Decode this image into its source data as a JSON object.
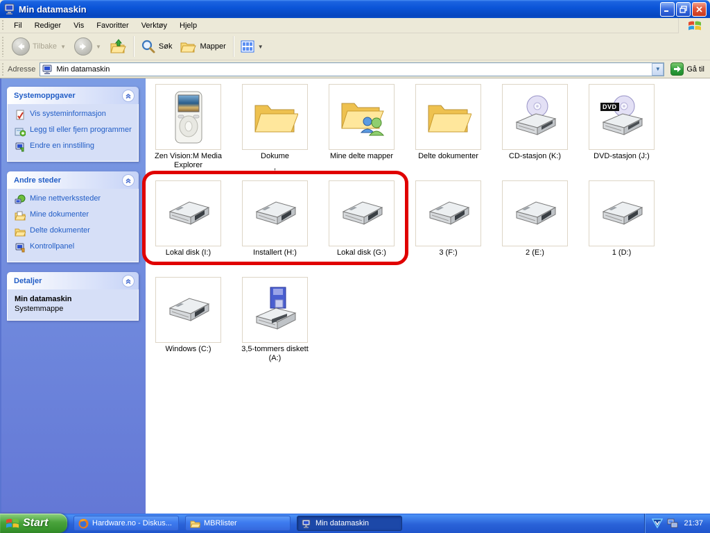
{
  "window": {
    "title": "Min datamaskin"
  },
  "menu": {
    "items": [
      "Fil",
      "Rediger",
      "Vis",
      "Favoritter",
      "Verktøy",
      "Hjelp"
    ]
  },
  "toolbar": {
    "back": "Tilbake",
    "search": "Søk",
    "folders": "Mapper"
  },
  "address": {
    "label": "Adresse",
    "value": "Min datamaskin",
    "go": "Gå til"
  },
  "sidebar": {
    "system_tasks": {
      "title": "Systemoppgaver",
      "items": [
        {
          "label": "Vis systeminformasjon",
          "icon": "system-info-icon"
        },
        {
          "label": "Legg til eller fjern programmer",
          "icon": "add-remove-programs-icon"
        },
        {
          "label": "Endre en innstilling",
          "icon": "change-setting-icon"
        }
      ]
    },
    "other_places": {
      "title": "Andre steder",
      "items": [
        {
          "label": "Mine nettverkssteder",
          "icon": "network-places-icon"
        },
        {
          "label": "Mine dokumenter",
          "icon": "my-documents-icon"
        },
        {
          "label": "Delte dokumenter",
          "icon": "shared-documents-icon"
        },
        {
          "label": "Kontrollpanel",
          "icon": "control-panel-icon"
        }
      ]
    },
    "details": {
      "title": "Detaljer",
      "name": "Min datamaskin",
      "type": "Systemmappe"
    }
  },
  "content": {
    "items": [
      {
        "label": "Zen Vision:M Media Explorer",
        "icon": "media-player-icon"
      },
      {
        "label": "Dokume",
        "label2": ",",
        "icon": "folder-icon"
      },
      {
        "label": "Mine delte mapper",
        "icon": "shared-folder-icon"
      },
      {
        "label": "Delte dokumenter",
        "icon": "folder-icon"
      },
      {
        "label": "CD-stasjon (K:)",
        "icon": "cd-drive-icon"
      },
      {
        "label": "DVD-stasjon (J:)",
        "icon": "dvd-drive-icon",
        "badge": "DVD"
      },
      {
        "label": "Lokal disk (I:)",
        "icon": "hdd-icon"
      },
      {
        "label": "Installert (H:)",
        "icon": "hdd-icon"
      },
      {
        "label": "Lokal disk (G:)",
        "icon": "hdd-icon"
      },
      {
        "label": "3 (F:)",
        "icon": "hdd-icon"
      },
      {
        "label": "2 (E:)",
        "icon": "hdd-icon"
      },
      {
        "label": "1 (D:)",
        "icon": "hdd-icon"
      },
      {
        "label": "Windows (C:)",
        "icon": "hdd-icon"
      },
      {
        "label": "3,5-tommers diskett (A:)",
        "icon": "floppy-drive-icon"
      }
    ],
    "annotation_color": "#e00000"
  },
  "taskbar": {
    "start_label": "Start",
    "tasks": [
      {
        "label": "Hardware.no - Diskus...",
        "icon": "firefox-icon",
        "active": false
      },
      {
        "label": "MBRlister",
        "icon": "folder-icon",
        "active": false
      },
      {
        "label": "Min datamaskin",
        "icon": "my-computer-icon",
        "active": true
      }
    ],
    "clock": "21:37"
  }
}
